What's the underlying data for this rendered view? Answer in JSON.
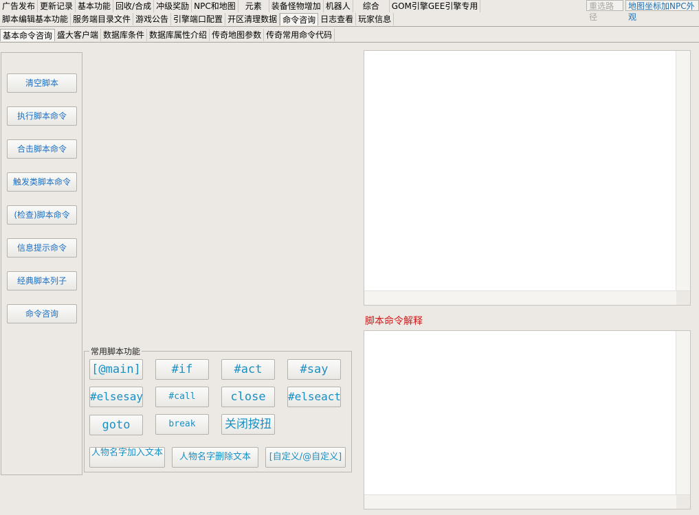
{
  "top_tabs_row1": [
    "广告发布",
    "更新记录",
    "基本功能",
    "回收/合成",
    "冲级奖励",
    "NPC和地图",
    "元素",
    "装备怪物增加",
    "机器人",
    "综合",
    "GOM引擎GEE引擎专用"
  ],
  "top_tabs_row2": [
    "脚本编辑基本功能",
    "服务端目录文件",
    "游戏公告",
    "引擎端口配置",
    "开区清理数据",
    "命令咨询",
    "日志查看",
    "玩家信息"
  ],
  "sub_tabs": [
    "基本命令咨询",
    "盛大客户端",
    "数据库条件",
    "数据库属性介绍",
    "传奇地图参数",
    "传奇常用命令代码"
  ],
  "toolbar": {
    "reselect_label": "重选路径",
    "map_label": "地图坐标加NPC外观"
  },
  "side_buttons": [
    "清空脚本",
    "执行脚本命令",
    "合击脚本命令",
    "触发类脚本命令",
    "(检查)脚本命令",
    "信息提示命令",
    "经典脚本列子",
    "命令咨询"
  ],
  "group": {
    "title": "常用脚本功能",
    "buttons": [
      "[@main]",
      "#if",
      "#act",
      "#say",
      "#elsesay",
      "#call",
      "close",
      "#elseact",
      "goto",
      "break",
      "关闭按扭",
      "人物名字加入文本",
      "人物名字删除文本",
      "[自定义/@自定义]"
    ]
  },
  "explain_label": "脚本命令解释",
  "colors": {
    "accent_blue": "#1a8fc4",
    "label_red": "#d21919"
  }
}
